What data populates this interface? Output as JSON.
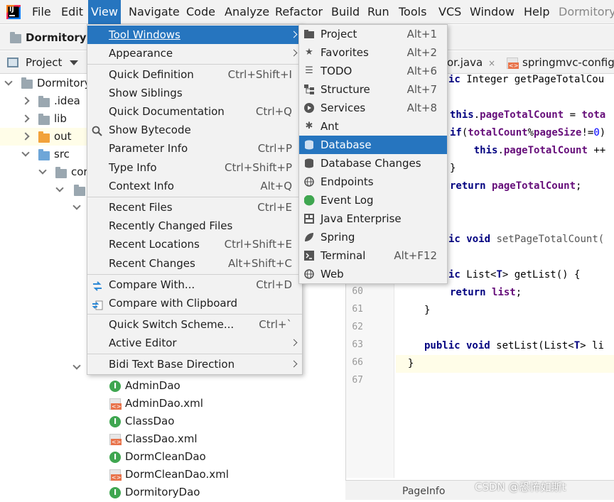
{
  "menubar": {
    "items": [
      {
        "label": "File"
      },
      {
        "label": "Edit"
      },
      {
        "label": "View"
      },
      {
        "label": "Navigate"
      },
      {
        "label": "Code"
      },
      {
        "label": "Analyze"
      },
      {
        "label": "Refactor"
      },
      {
        "label": "Build"
      },
      {
        "label": "Run"
      },
      {
        "label": "Tools"
      },
      {
        "label": "VCS"
      },
      {
        "label": "Window"
      },
      {
        "label": "Help"
      }
    ],
    "project_title": "Dormitory"
  },
  "navbar": {
    "crumb": "DormitoryM"
  },
  "project_panel": {
    "label": "Project",
    "tree": [
      {
        "label": "Dormitory"
      },
      {
        "label": ".idea"
      },
      {
        "label": "lib"
      },
      {
        "label": "out"
      },
      {
        "label": "src"
      },
      {
        "label": "cor"
      },
      {
        "label": "AdminDao"
      },
      {
        "label": "AdminDao.xml"
      },
      {
        "label": "ClassDao"
      },
      {
        "label": "ClassDao.xml"
      },
      {
        "label": "DormCleanDao"
      },
      {
        "label": "DormCleanDao.xml"
      },
      {
        "label": "DormitoryDao"
      }
    ]
  },
  "editor": {
    "tabs": [
      {
        "label": "or.java"
      },
      {
        "label": "springmvc-config"
      }
    ],
    "line_numbers": [
      "60",
      "61",
      "62",
      "63",
      "66",
      "67"
    ],
    "code": [
      "ic Integer getPageTotalCou",
      "this.pageTotalCount = tota",
      "if(totalCount%pageSize!=0)",
      "    this.pageTotalCount ++",
      "}",
      "return pageTotalCount;",
      "ic void setPageTotalCount(",
      "ic List<T> getList() {",
      "return list;",
      "}",
      "public void setList(List<T> li",
      "}"
    ]
  },
  "statusbar": {
    "page_info": "PageInfo"
  },
  "watermark": "CSDN @恐怖如斯t",
  "view_menu": {
    "items": [
      {
        "label": "Tool Windows",
        "shortcut": ""
      },
      {
        "label": "Appearance",
        "shortcut": ""
      },
      {
        "label": "Quick Definition",
        "shortcut": "Ctrl+Shift+I"
      },
      {
        "label": "Show Siblings",
        "shortcut": ""
      },
      {
        "label": "Quick Documentation",
        "shortcut": "Ctrl+Q"
      },
      {
        "label": "Show Bytecode",
        "shortcut": ""
      },
      {
        "label": "Parameter Info",
        "shortcut": "Ctrl+P"
      },
      {
        "label": "Type Info",
        "shortcut": "Ctrl+Shift+P"
      },
      {
        "label": "Context Info",
        "shortcut": "Alt+Q"
      },
      {
        "label": "Recent Files",
        "shortcut": "Ctrl+E"
      },
      {
        "label": "Recently Changed Files",
        "shortcut": ""
      },
      {
        "label": "Recent Locations",
        "shortcut": "Ctrl+Shift+E"
      },
      {
        "label": "Recent Changes",
        "shortcut": "Alt+Shift+C"
      },
      {
        "label": "Compare With...",
        "shortcut": "Ctrl+D"
      },
      {
        "label": "Compare with Clipboard",
        "shortcut": ""
      },
      {
        "label": "Quick Switch Scheme...",
        "shortcut": "Ctrl+`"
      },
      {
        "label": "Active Editor",
        "shortcut": ""
      },
      {
        "label": "Bidi Text Base Direction",
        "shortcut": ""
      }
    ]
  },
  "tool_windows_menu": {
    "items": [
      {
        "label": "Project",
        "shortcut": "Alt+1"
      },
      {
        "label": "Favorites",
        "shortcut": "Alt+2"
      },
      {
        "label": "TODO",
        "shortcut": "Alt+6"
      },
      {
        "label": "Structure",
        "shortcut": "Alt+7"
      },
      {
        "label": "Services",
        "shortcut": "Alt+8"
      },
      {
        "label": "Ant",
        "shortcut": ""
      },
      {
        "label": "Database",
        "shortcut": ""
      },
      {
        "label": "Database Changes",
        "shortcut": ""
      },
      {
        "label": "Endpoints",
        "shortcut": ""
      },
      {
        "label": "Event Log",
        "shortcut": ""
      },
      {
        "label": "Java Enterprise",
        "shortcut": ""
      },
      {
        "label": "Spring",
        "shortcut": ""
      },
      {
        "label": "Terminal",
        "shortcut": "Alt+F12"
      },
      {
        "label": "Web",
        "shortcut": ""
      }
    ]
  },
  "colors": {
    "selection": "#2675bf",
    "menu_bg": "#f2f2f2",
    "keyword": "#000080",
    "field": "#660e7a"
  }
}
